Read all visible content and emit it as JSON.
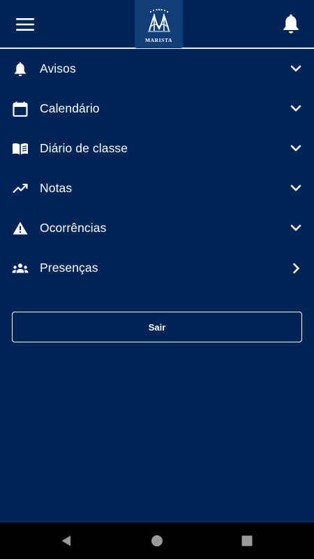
{
  "app_bar": {
    "menu_icon": "hamburger-menu-icon",
    "logo_text": "MARISTA",
    "notification_icon": "bell-icon"
  },
  "menu": {
    "items": [
      {
        "label": "Avisos",
        "icon": "bell-icon",
        "chevron": "chevron-down-icon"
      },
      {
        "label": "Calendário",
        "icon": "calendar-icon",
        "chevron": "chevron-down-icon"
      },
      {
        "label": "Diário de classe",
        "icon": "open-book-icon",
        "chevron": "chevron-down-icon"
      },
      {
        "label": "Notas",
        "icon": "trending-up-icon",
        "chevron": "chevron-down-icon"
      },
      {
        "label": "Ocorrências",
        "icon": "warning-icon",
        "chevron": "chevron-down-icon"
      },
      {
        "label": "Presenças",
        "icon": "group-icon",
        "chevron": "chevron-right-icon"
      }
    ]
  },
  "logout": {
    "label": "Sair"
  },
  "system_nav": {
    "back_icon": "back-triangle-icon",
    "home_icon": "home-circle-icon",
    "recents_icon": "recents-square-icon"
  },
  "colors": {
    "background": "#012456",
    "logo_background": "#0f3e78",
    "text": "#ffffff",
    "divider": "#e8ecf2",
    "nav_bar": "#000000"
  }
}
